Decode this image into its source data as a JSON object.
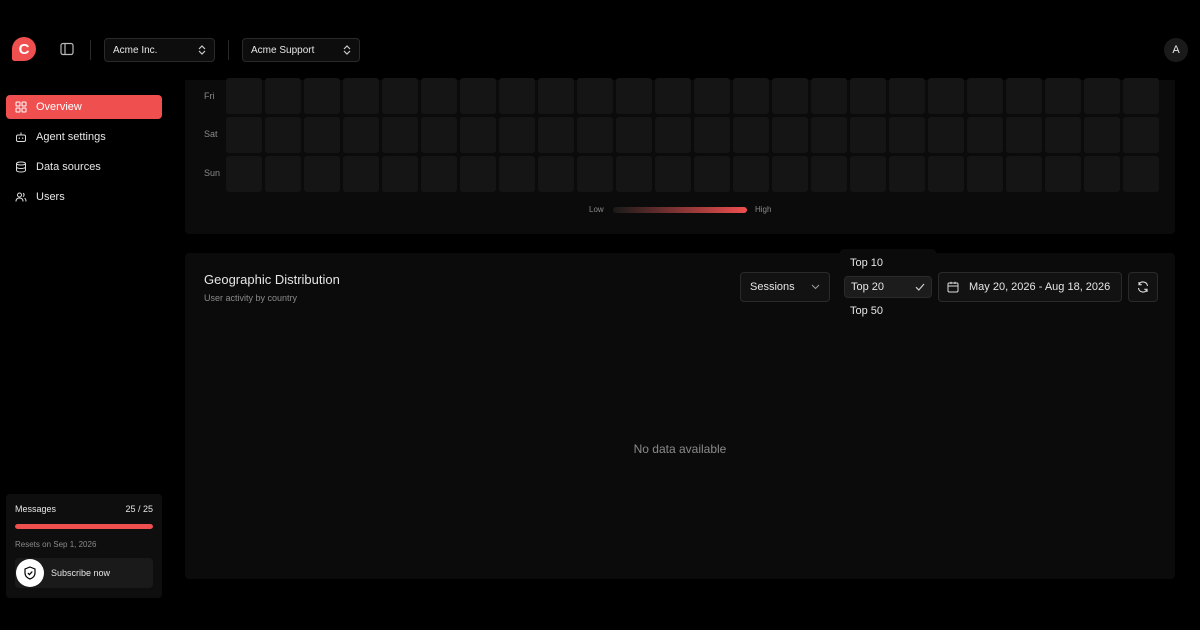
{
  "header": {
    "logo_letter": "C",
    "org_select": "Acme Inc.",
    "agent_select": "Acme Support",
    "avatar_initial": "A"
  },
  "sidebar": {
    "items": [
      {
        "label": "Overview",
        "icon": "grid-icon",
        "active": true
      },
      {
        "label": "Agent settings",
        "icon": "robot-icon",
        "active": false
      },
      {
        "label": "Data sources",
        "icon": "database-icon",
        "active": false
      },
      {
        "label": "Users",
        "icon": "users-icon",
        "active": false
      }
    ]
  },
  "messages": {
    "title": "Messages",
    "count": "25 / 25",
    "used_fraction": 1.0,
    "reset_text": "Resets on Sep 1, 2026",
    "subscribe_label": "Subscribe now"
  },
  "heatmap": {
    "day_labels": [
      "Fri",
      "Sat",
      "Sun"
    ],
    "columns": 24,
    "legend_low": "Low",
    "legend_high": "High"
  },
  "geo": {
    "title": "Geographic Distribution",
    "subtitle": "User activity by country",
    "metric_select": "Sessions",
    "date_range": "May 20, 2026 - Aug 18, 2026",
    "empty_text": "No data available",
    "limit_options": [
      "Top 10",
      "Top 20",
      "Top 50"
    ],
    "selected_limit": "Top 20"
  },
  "colors": {
    "accent": "#ef4f4f",
    "background": "#000000",
    "card": "#0b0b0b"
  }
}
